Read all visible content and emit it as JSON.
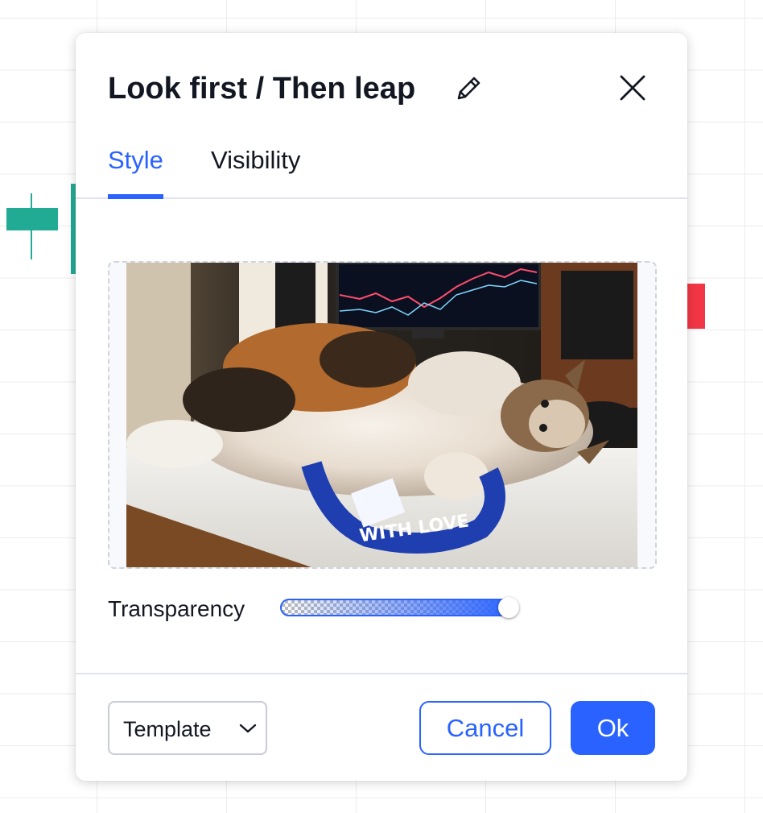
{
  "dialog": {
    "title": "Look first / Then leap",
    "tabs": [
      {
        "label": "Style",
        "active": true
      },
      {
        "label": "Visibility",
        "active": false
      }
    ],
    "image_alt": "Calico cat lying on a desk with a blue MADE WITH LOVE lanyard, monitor showing a chart behind",
    "transparency": {
      "label": "Transparency",
      "value_fraction": 0.96
    },
    "footer": {
      "template_label": "Template",
      "cancel_label": "Cancel",
      "ok_label": "Ok"
    }
  },
  "colors": {
    "accent": "#2962ff",
    "candle_up": "#22ab94",
    "candle_down": "#f23645",
    "text": "#131722"
  },
  "icons": {
    "edit": "pencil-icon",
    "close": "close-icon",
    "dropdown": "chevron-down-icon"
  }
}
